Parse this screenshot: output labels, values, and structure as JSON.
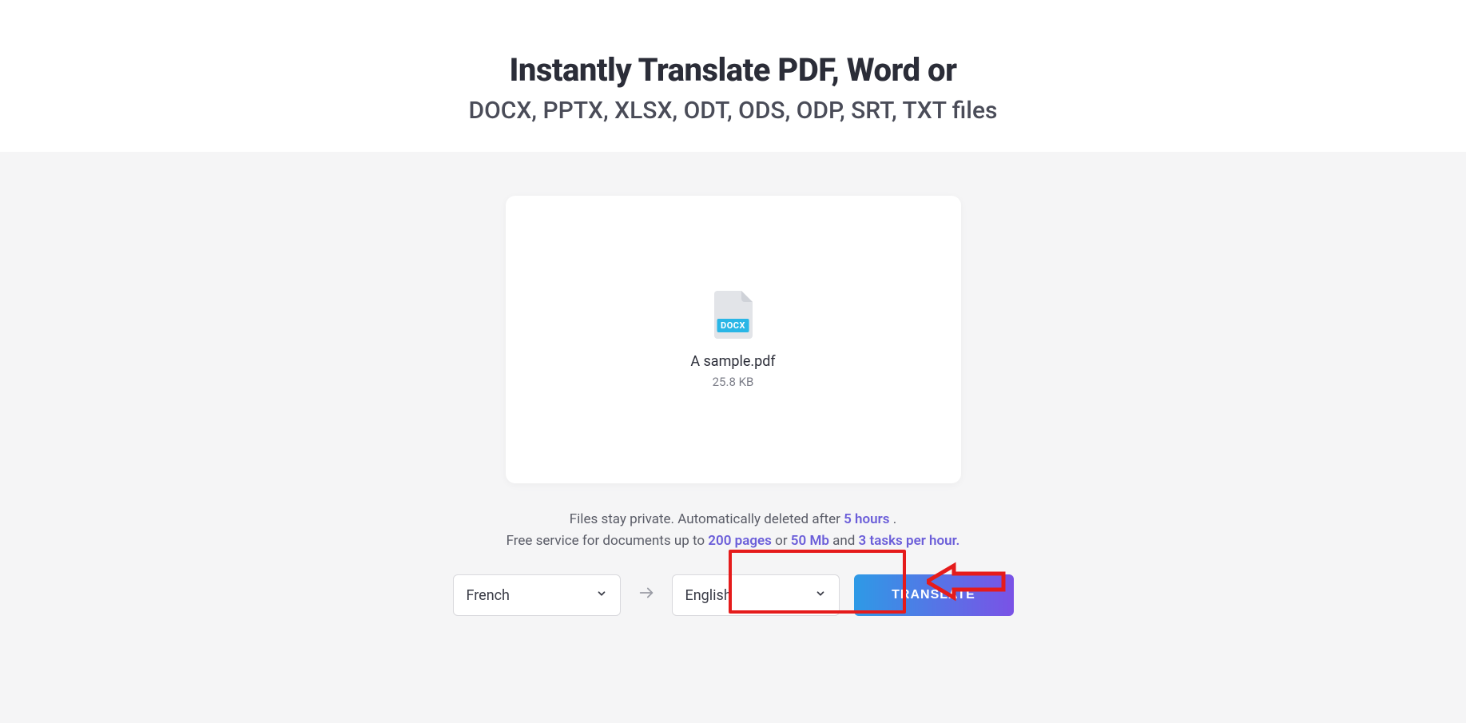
{
  "hero": {
    "title": "Instantly Translate PDF, Word or",
    "subtitle": "DOCX, PPTX, XLSX, ODT, ODS, ODP, SRT, TXT files"
  },
  "upload": {
    "file_type_badge": "DOCX",
    "file_name": "A sample.pdf",
    "file_size": "25.8 KB"
  },
  "info": {
    "line1_prefix": "Files stay private. Automatically deleted after ",
    "line1_em": "5 hours",
    "line1_suffix": " .",
    "line2_prefix": "Free service for documents up to ",
    "line2_em1": "200 pages",
    "line2_mid1": " or ",
    "line2_em2": "50 Mb",
    "line2_mid2": " and ",
    "line2_em3": "3 tasks per hour.",
    "line2_suffix": ""
  },
  "controls": {
    "source_language": "French",
    "target_language": "English",
    "translate_label": "TRANSLATE"
  },
  "icons": {
    "quote": "❝",
    "merge": "⅄",
    "grid": "⊞",
    "stripes": "〃",
    "bookmark": "🔖",
    "bookmark2": "🔖",
    "puzzle": "🧩",
    "plus": "＋",
    "cloud": "☁",
    "plus2": "＋",
    "paint": "🖌",
    "wave": "≈",
    "wave2": "≈",
    "doc": "▤"
  }
}
